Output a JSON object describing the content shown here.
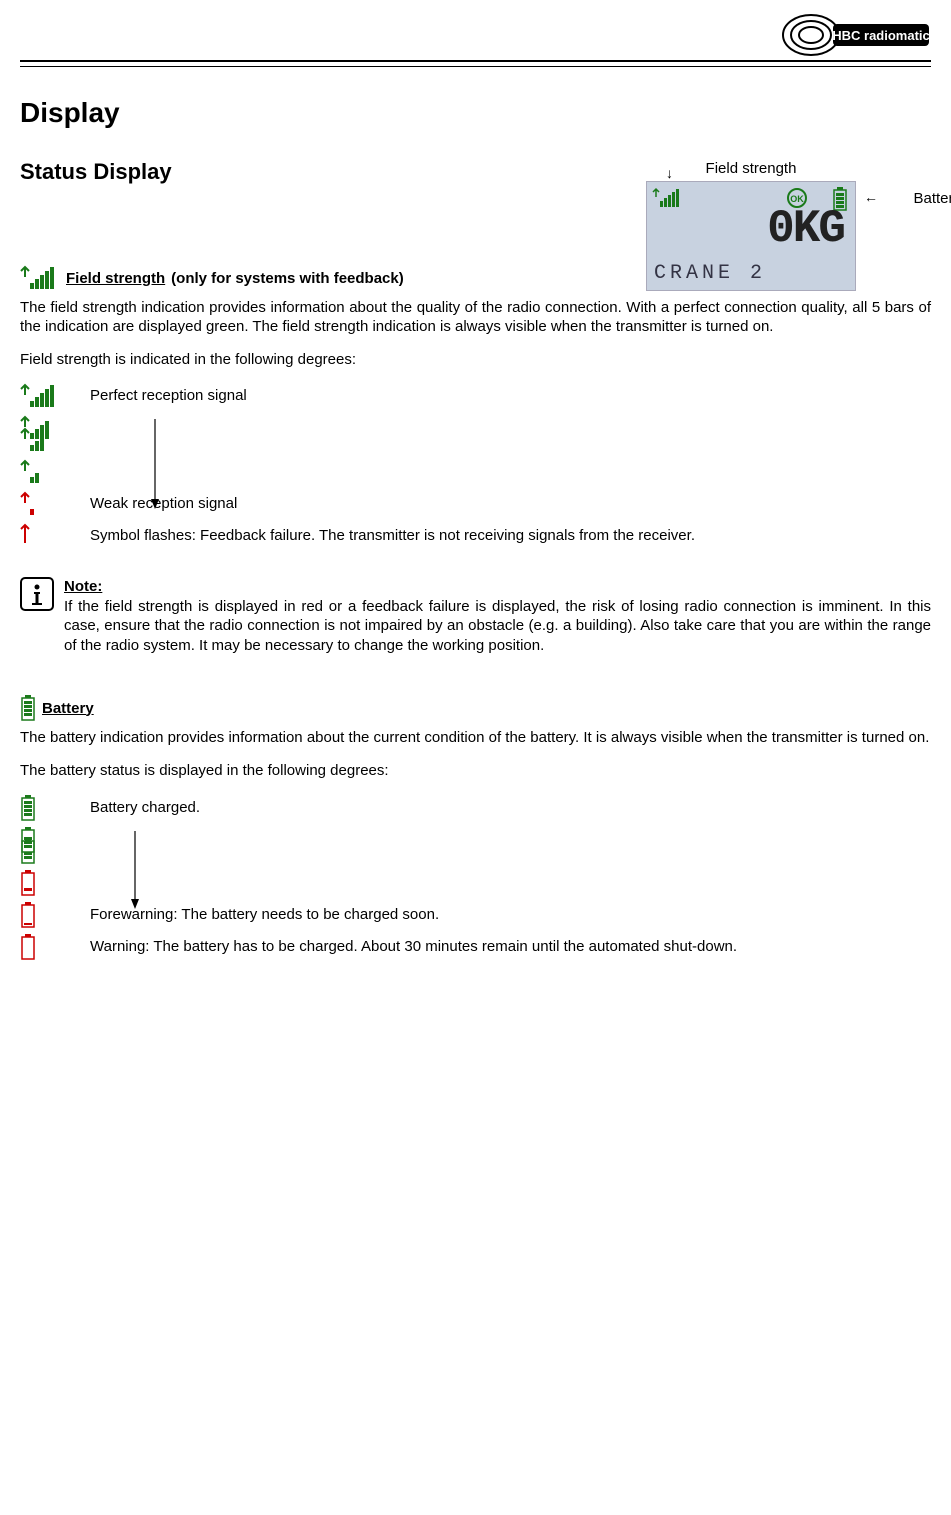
{
  "header": {
    "brand": "HBC radiomatic"
  },
  "titles": {
    "h1": "Display",
    "h2": "Status Display"
  },
  "lcd": {
    "label_top": "Field strength",
    "label_right": "Battery",
    "big": "0KG",
    "small": "CRANE 2"
  },
  "field_strength": {
    "heading_label": "Field strength",
    "heading_suffix": "(only for systems with feedback)",
    "intro": "The field strength indication provides information about the quality of the radio connection. With a perfect connection quality, all 5 bars of the indication are displayed green. The field strength indication is always visible when the transmitter is turned on.",
    "degrees_intro": "Field strength is indicated in the following degrees:",
    "rows": {
      "perfect": "Perfect reception signal",
      "weak": "Weak reception signal",
      "flash": "Symbol flashes: Feedback failure. The transmitter is not receiving signals from the receiver."
    }
  },
  "note": {
    "title": "Note:",
    "body": "If the field strength is displayed in red or a feedback failure is displayed, the risk of losing radio connection is  imminent. In this case, ensure that the radio connection is not impaired by an obstacle (e.g. a building). Also take care that you are within the range of the radio system. It may be necessary to change the working position."
  },
  "battery": {
    "heading_label": "Battery",
    "intro": "The battery indication provides information about the current condition of the battery. It is always visible when the transmitter is turned on.",
    "degrees_intro": "The battery status is displayed in the following degrees:",
    "rows": {
      "charged": "Battery charged.",
      "forewarn": "Forewarning: The battery needs to be charged soon.",
      "warn": "Warning: The battery has to be charged. About 30 minutes remain until the automated shut-down."
    }
  }
}
